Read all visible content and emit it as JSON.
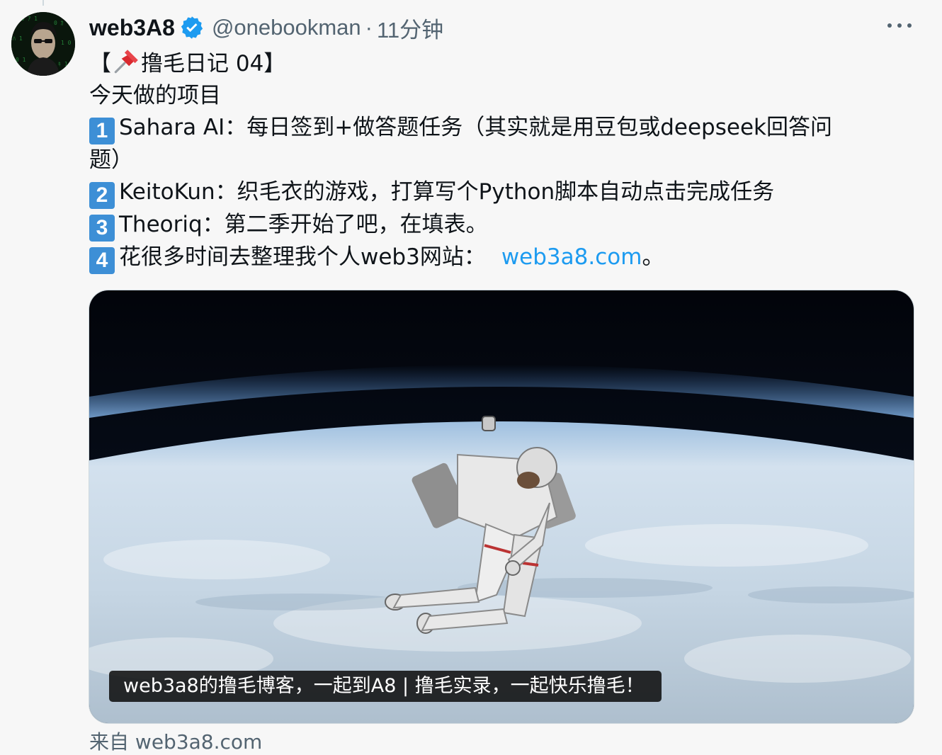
{
  "tweet": {
    "author_name": "web3A8",
    "author_handle": "@onebookman",
    "separator": "·",
    "timestamp": "11分钟",
    "lines": {
      "title": "【📌撸毛日记 04】",
      "title_open": "【",
      "title_text": "撸毛日记 04】",
      "intro": "今天做的项目",
      "item1_num": "1",
      "item1_text": "Sahara AI：每日签到+做答题任务（其实就是用豆包或deepseek回答问",
      "item1_cont": "题）",
      "item2_num": "2",
      "item2_text": "KeitoKun：织毛衣的游戏，打算写个Python脚本自动点击完成任务",
      "item3_num": "3",
      "item3_text": "Theoriq：第二季开始了吧，在填表。",
      "item4_num": "4",
      "item4_text": "花很多时间去整理我个人web3网站：",
      "item4_link": "web3a8.com",
      "item4_end": "。"
    },
    "media_caption": "web3a8的撸毛博客，一起到A8 | 撸毛实录，一起快乐撸毛！",
    "source_prefix": "来自",
    "source_link": "web3a8.com"
  },
  "icons": {
    "verified": "verified-badge-icon",
    "more": "more-options-icon",
    "pin": "pushpin-emoji"
  },
  "colors": {
    "link": "#1d9bf0",
    "verified": "#1d9bf0",
    "number_box": "#3d8fd6",
    "secondary_text": "#536471"
  }
}
